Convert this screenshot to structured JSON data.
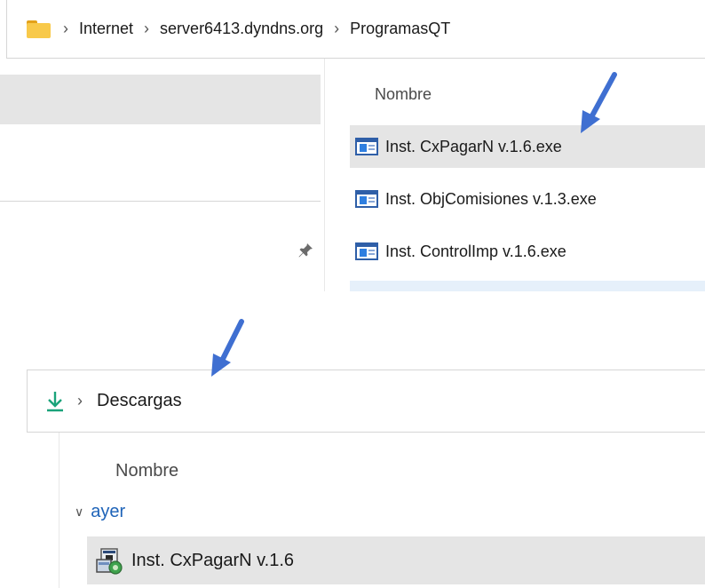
{
  "explorer": {
    "breadcrumb": [
      "Internet",
      "server6413.dyndns.org",
      "ProgramasQT"
    ],
    "column_header": "Nombre",
    "files": [
      {
        "name": "Inst. CxPagarN v.1.6.exe",
        "selected": true,
        "icon": "exe-file-icon"
      },
      {
        "name": "Inst. ObjComisiones v.1.3.exe",
        "selected": false,
        "icon": "exe-file-icon"
      },
      {
        "name": "Inst. ControlImp v.1.6.exe",
        "selected": false,
        "icon": "exe-file-icon"
      }
    ]
  },
  "downloads": {
    "breadcrumb": [
      "Descargas"
    ],
    "column_header": "Nombre",
    "group_label": "ayer",
    "items": [
      {
        "name": "Inst. CxPagarN v.1.6",
        "selected": true,
        "icon": "setup-installer-icon"
      }
    ]
  },
  "colors": {
    "selection_bg": "#e5e5e5",
    "accent_blue": "#1e63b8",
    "annotation_arrow": "#3f6fd1",
    "download_green": "#1aa37a",
    "folder_yellow": "#f8c94a"
  }
}
